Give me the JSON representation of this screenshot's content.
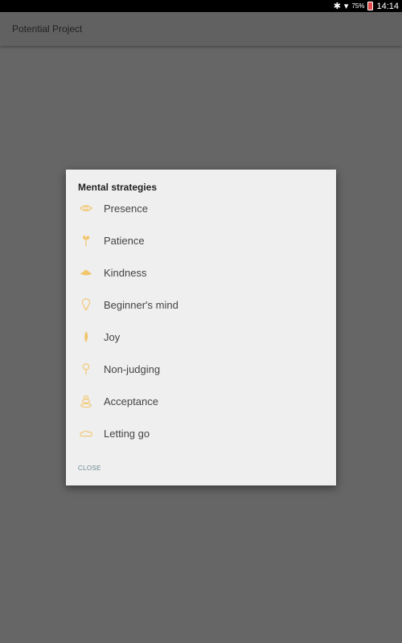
{
  "status_bar": {
    "bluetooth_icon": "bluetooth-icon",
    "wifi_icon": "wifi-icon",
    "battery_percent": "75%",
    "battery_icon": "battery-charging-icon",
    "time": "14:14"
  },
  "app_bar": {
    "title": "Potential Project"
  },
  "dialog": {
    "title": "Mental strategies",
    "icon_color": "#f2c66d",
    "items": [
      {
        "label": "Presence",
        "icon": "eye-icon"
      },
      {
        "label": "Patience",
        "icon": "flower-icon"
      },
      {
        "label": "Kindness",
        "icon": "lotus-icon"
      },
      {
        "label": "Beginner's mind",
        "icon": "lightbulb-icon"
      },
      {
        "label": "Joy",
        "icon": "flame-icon"
      },
      {
        "label": "Non-judging",
        "icon": "sprout-icon"
      },
      {
        "label": "Acceptance",
        "icon": "stacked-stones-icon"
      },
      {
        "label": "Letting go",
        "icon": "clouds-icon"
      }
    ],
    "close_label": "CLOSE"
  }
}
